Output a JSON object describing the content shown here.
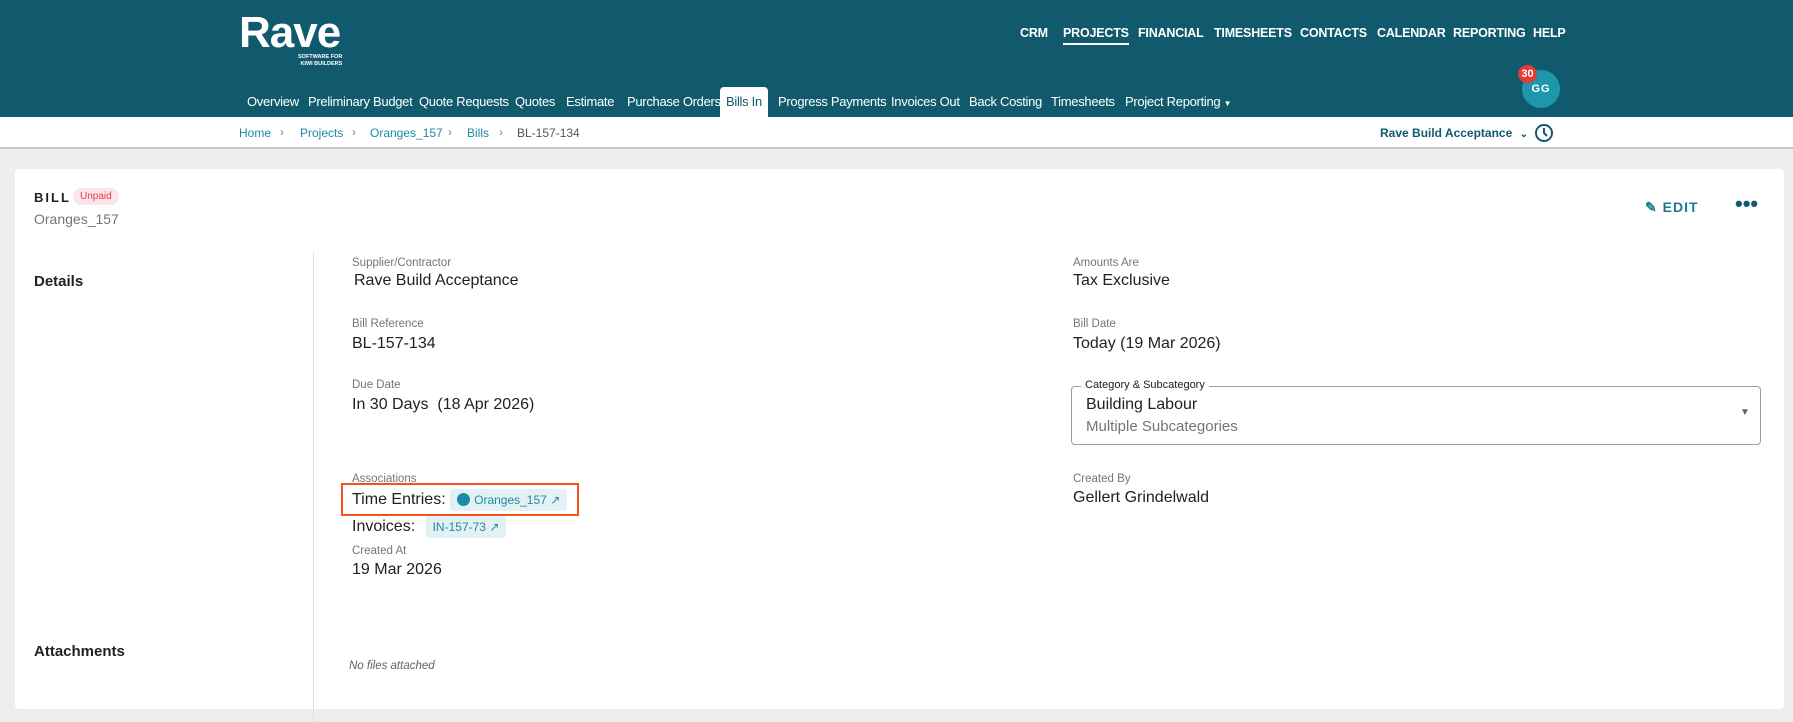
{
  "brand": {
    "name": "Rave",
    "tagline_line1": "SOFTWARE FOR",
    "tagline_line2": "KIWI BUILDERS"
  },
  "top_nav": [
    "CRM",
    "PROJECTS",
    "FINANCIAL",
    "TIMESHEETS",
    "CONTACTS",
    "CALENDAR",
    "REPORTING",
    "HELP"
  ],
  "tabs": [
    "Overview",
    "Preliminary Budget",
    "Quote Requests",
    "Quotes",
    "Estimate",
    "Purchase Orders",
    "Bills In",
    "Progress Payments",
    "Invoices Out",
    "Back Costing",
    "Timesheets",
    "Project Reporting"
  ],
  "user": {
    "initials": "GG",
    "notifications": "30"
  },
  "breadcrumb": [
    "Home",
    "Projects",
    "Oranges_157",
    "Bills",
    "BL-157-134"
  ],
  "company_selector": "Rave Build Acceptance",
  "bill": {
    "type": "BILL",
    "status": "Unpaid",
    "project": "Oranges_157",
    "edit_label": "EDIT",
    "details_heading": "Details",
    "attachments_heading": "Attachments",
    "no_files": "No files attached",
    "supplier_label": "Supplier/Contractor",
    "supplier": "Rave Build Acceptance",
    "reference_label": "Bill Reference",
    "reference": "BL-157-134",
    "due_label": "Due Date",
    "due": "In 30 Days  (18 Apr 2026)",
    "associations_label": "Associations",
    "time_entries_label": "Time Entries:",
    "time_entries_link": "Oranges_157",
    "invoices_label": "Invoices:",
    "invoices_link": "IN-157-73",
    "created_at_label": "Created At",
    "created_at": "19 Mar 2026",
    "amounts_label": "Amounts Are",
    "amounts": "Tax Exclusive",
    "bill_date_label": "Bill Date",
    "bill_date": "Today (19 Mar 2026)",
    "category_label": "Category & Subcategory",
    "category": "Building Labour",
    "subcategory": "Multiple Subcategories",
    "created_by_label": "Created By",
    "created_by": "Gellert Grindelwald"
  },
  "colors": {
    "header": "#115a6d",
    "accent": "#1e8aa3",
    "highlight": "#f4511e",
    "unpaid": "#e53950"
  }
}
